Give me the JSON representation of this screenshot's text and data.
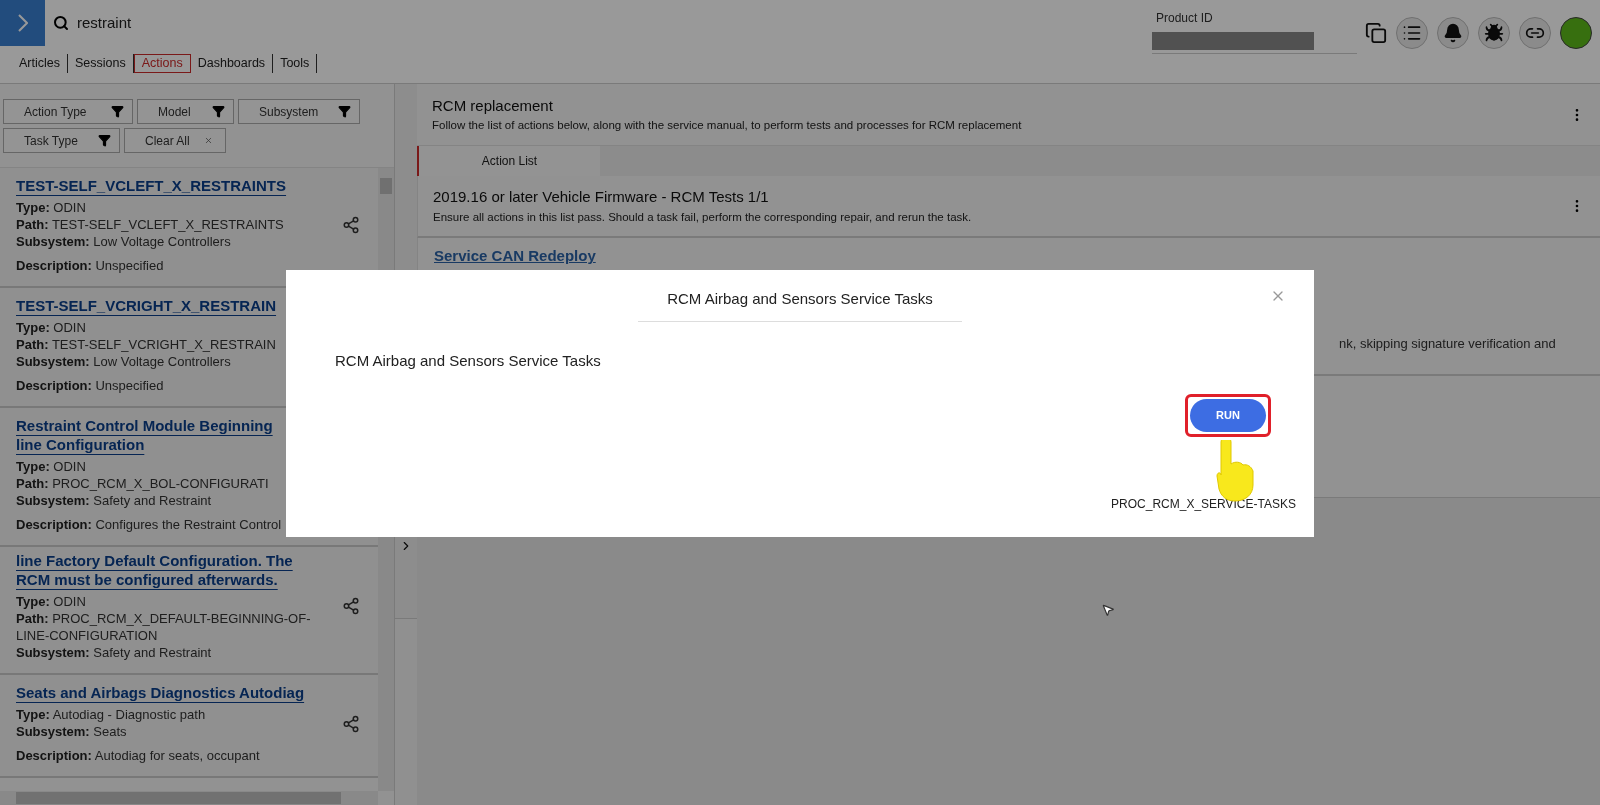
{
  "search": {
    "value": "restraint"
  },
  "nav_tabs": [
    {
      "label": "Articles",
      "selected": false
    },
    {
      "label": "Sessions",
      "selected": false
    },
    {
      "label": "Actions",
      "selected": true
    },
    {
      "label": "Dashboards",
      "selected": false
    },
    {
      "label": "Tools",
      "selected": false
    }
  ],
  "product_id": {
    "label": "Product ID"
  },
  "filters": [
    {
      "label": "Action Type",
      "kind": "filter"
    },
    {
      "label": "Model",
      "kind": "filter"
    },
    {
      "label": "Subsystem",
      "kind": "filter"
    },
    {
      "label": "Task Type",
      "kind": "filter"
    },
    {
      "label": "Clear All",
      "kind": "clear"
    }
  ],
  "results": [
    {
      "title_lines": [
        "TEST-SELF_VCLEFT_X_RESTRAINTS"
      ],
      "fields": [
        {
          "label": "Type:",
          "value": "ODIN"
        },
        {
          "label": "Path:",
          "value": "TEST-SELF_VCLEFT_X_RESTRAINTS"
        },
        {
          "label": "Subsystem:",
          "value": "Low Voltage Controllers"
        }
      ],
      "description": {
        "label": "Description:",
        "value": "Unspecified"
      },
      "share": true
    },
    {
      "title_lines": [
        "TEST-SELF_VCRIGHT_X_RESTRAIN"
      ],
      "fields": [
        {
          "label": "Type:",
          "value": "ODIN"
        },
        {
          "label": "Path:",
          "value": "TEST-SELF_VCRIGHT_X_RESTRAIN"
        },
        {
          "label": "Subsystem:",
          "value": "Low Voltage Controllers"
        }
      ],
      "description": {
        "label": "Description:",
        "value": "Unspecified"
      }
    },
    {
      "title_lines": [
        "Restraint Control Module Beginning",
        "line Configuration"
      ],
      "fields": [
        {
          "label": "Type:",
          "value": "ODIN"
        },
        {
          "label": "Path:",
          "value": "PROC_RCM_X_BOL-CONFIGURATI"
        },
        {
          "label": "Subsystem:",
          "value": "Safety and Restraint"
        }
      ],
      "description": {
        "label": "Description:",
        "value": "Configures the Restraint Control"
      }
    },
    {
      "title_lines": [
        "line Factory Default Configuration. The",
        "RCM must be configured afterwards."
      ],
      "fields": [
        {
          "label": "Type:",
          "value": "ODIN"
        },
        {
          "label": "Path:",
          "value": "PROC_RCM_X_DEFAULT-BEGINNING-OF-LINE-CONFIGURATION"
        },
        {
          "label": "Subsystem:",
          "value": "Safety and Restraint"
        }
      ],
      "share": true
    },
    {
      "title_lines": [
        "Seats and Airbags Diagnostics Autodiag"
      ],
      "fields": [
        {
          "label": "Type:",
          "value": "Autodiag - Diagnostic path"
        },
        {
          "label": "Subsystem:",
          "value": "Seats"
        }
      ],
      "description": {
        "label": "Description:",
        "value": "Autodiag for seats, occupant"
      },
      "share": true
    }
  ],
  "procedure": {
    "title": "RCM replacement",
    "subtitle": "Follow the list of actions below, along with the service manual, to perform tests and processes for RCM replacement"
  },
  "content_tabs": [
    {
      "label": "Action List",
      "selected": true
    }
  ],
  "action_list": {
    "title": "2019.16 or later Vehicle Firmware - RCM Tests 1/1",
    "subtitle": "Ensure all actions in this list pass. Should a task fail, perform the corresponding repair, and rerun the task."
  },
  "actions": [
    {
      "title": "Service CAN Redeploy",
      "description": "nk, skipping signature verification and"
    }
  ],
  "modal": {
    "header": "RCM Airbag and Sensors Service Tasks",
    "body": "RCM Airbag and Sensors Service Tasks",
    "button": "RUN",
    "path": "PROC_RCM_X_SERVICE-TASKS"
  }
}
